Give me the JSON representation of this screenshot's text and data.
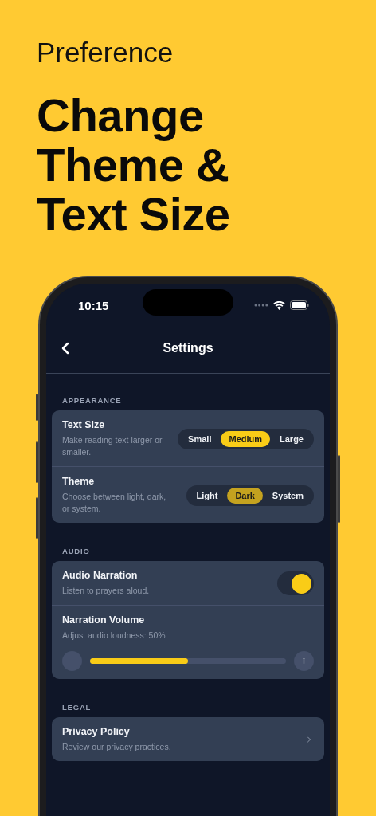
{
  "header": {
    "eyebrow": "Preference",
    "headline": [
      "Change",
      "Theme &",
      "Text Size"
    ]
  },
  "status_bar": {
    "time": "10:15"
  },
  "nav": {
    "title": "Settings"
  },
  "sections": [
    {
      "label": "APPEARANCE",
      "rows": [
        {
          "kind": "segmented",
          "title": "Text Size",
          "subtitle": "Make reading text larger or smaller.",
          "color": "#f9cc17",
          "options": [
            {
              "label": "Small",
              "selected": false
            },
            {
              "label": "Medium",
              "selected": true
            },
            {
              "label": "Large",
              "selected": false
            }
          ]
        },
        {
          "kind": "segmented",
          "title": "Theme",
          "subtitle": "Choose between light, dark, or system.",
          "color": "#c4a21f",
          "options": [
            {
              "label": "Light",
              "selected": false
            },
            {
              "label": "Dark",
              "selected": true
            },
            {
              "label": "System",
              "selected": false
            }
          ]
        }
      ]
    },
    {
      "label": "AUDIO",
      "rows": [
        {
          "kind": "toggle",
          "title": "Audio Narration",
          "subtitle": "Listen to prayers aloud.",
          "on": true
        },
        {
          "kind": "slider",
          "title": "Narration Volume",
          "subtitle": "Adjust audio loudness: 50%",
          "level": 0.5
        }
      ]
    },
    {
      "label": "LEGAL",
      "rows": [
        {
          "kind": "link",
          "title": "Privacy Policy",
          "subtitle": "Review our privacy practices."
        }
      ]
    }
  ]
}
